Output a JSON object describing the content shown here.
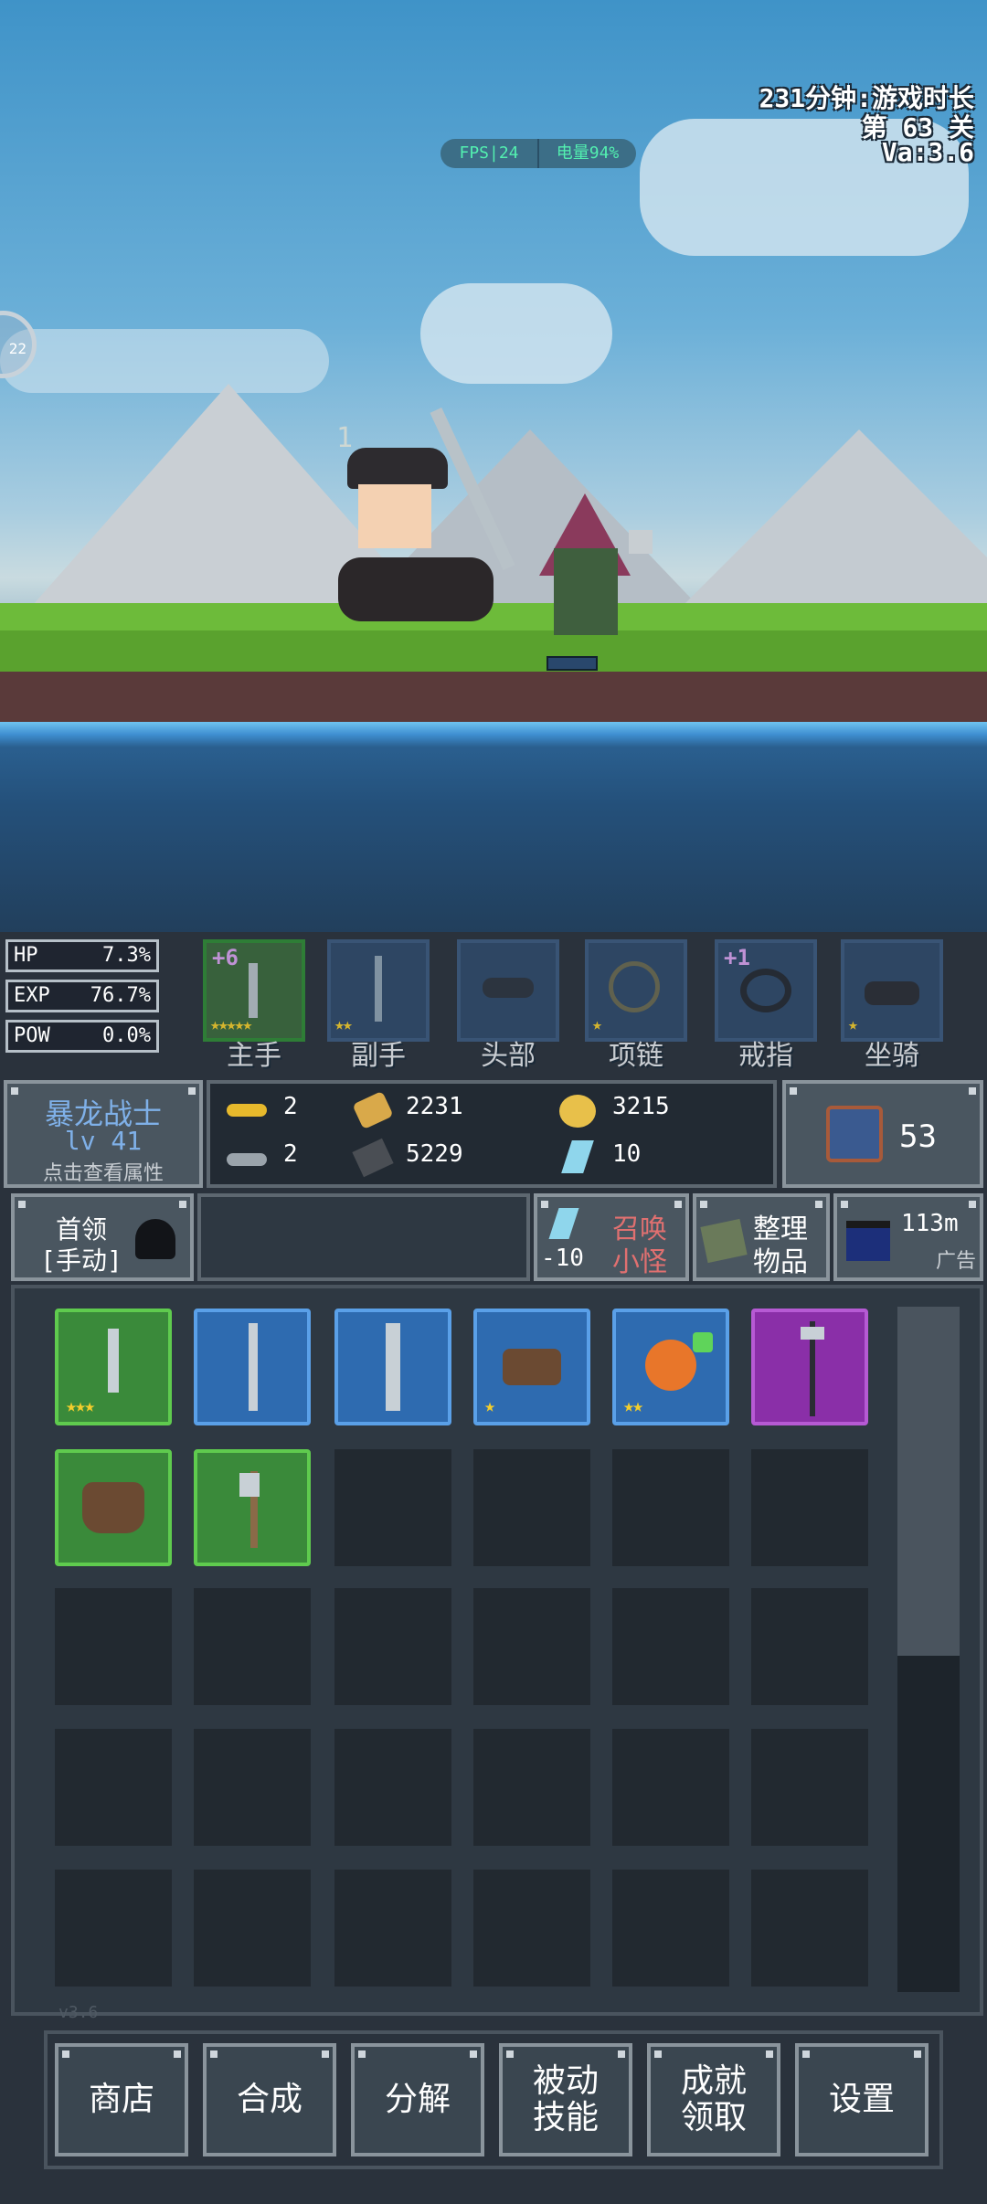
{
  "hud": {
    "play_time": "231分钟:游戏时长",
    "stage": "第 63 关",
    "version_tag": "Va:3.6",
    "fps": "FPS|24",
    "battery": "电量94%",
    "timer_text": "22",
    "damage_number": "1"
  },
  "stats": [
    {
      "label": "HP",
      "value": "7.3%"
    },
    {
      "label": "EXP",
      "value": "76.7%"
    },
    {
      "label": "POW",
      "value": "0.0%"
    }
  ],
  "equipment": [
    {
      "label": "主手",
      "plus": "+6",
      "stars": "★★★★★",
      "rarity": "green"
    },
    {
      "label": "副手",
      "plus": "",
      "stars": "★★",
      "rarity": "blue"
    },
    {
      "label": "头部",
      "plus": "",
      "stars": "",
      "rarity": "blue"
    },
    {
      "label": "项链",
      "plus": "",
      "stars": "★",
      "rarity": "blue"
    },
    {
      "label": "戒指",
      "plus": "+1",
      "stars": "",
      "rarity": "blue"
    },
    {
      "label": "坐骑",
      "plus": "",
      "stars": "★",
      "rarity": "blue"
    }
  ],
  "character": {
    "class_name": "暴龙战士",
    "level": "lv 41",
    "hint": "点击查看属性"
  },
  "resources": {
    "gold_key": "2",
    "silver_key": "2",
    "bread": "2231",
    "iron": "5229",
    "coin": "3215",
    "crystal": "10",
    "chest_count": "53"
  },
  "actions": {
    "boss_line1": "首领",
    "boss_line2": "[手动]",
    "summon_cost": "-10",
    "summon_line1": "召唤",
    "summon_line2": "小怪",
    "organize_line1": "整理",
    "organize_line2": "物品",
    "ad_time": "113m",
    "ad_label": "广告"
  },
  "inventory_version": "v3.6",
  "bottom_menu": [
    {
      "line1": "商店",
      "line2": ""
    },
    {
      "line1": "合成",
      "line2": ""
    },
    {
      "line1": "分解",
      "line2": ""
    },
    {
      "line1": "被动",
      "line2": "技能"
    },
    {
      "line1": "成就",
      "line2": "领取"
    },
    {
      "line1": "设置",
      "line2": ""
    }
  ],
  "colors": {
    "sky_top": "#3f93c8",
    "grass": "#6dbb3a",
    "water": "#3f8fd1",
    "rarity_green": "#3a8a3a",
    "rarity_blue": "#2e6bb0",
    "rarity_purple": "#8a2fa8",
    "star": "#f3cd2c",
    "summon_red": "#e07070"
  }
}
